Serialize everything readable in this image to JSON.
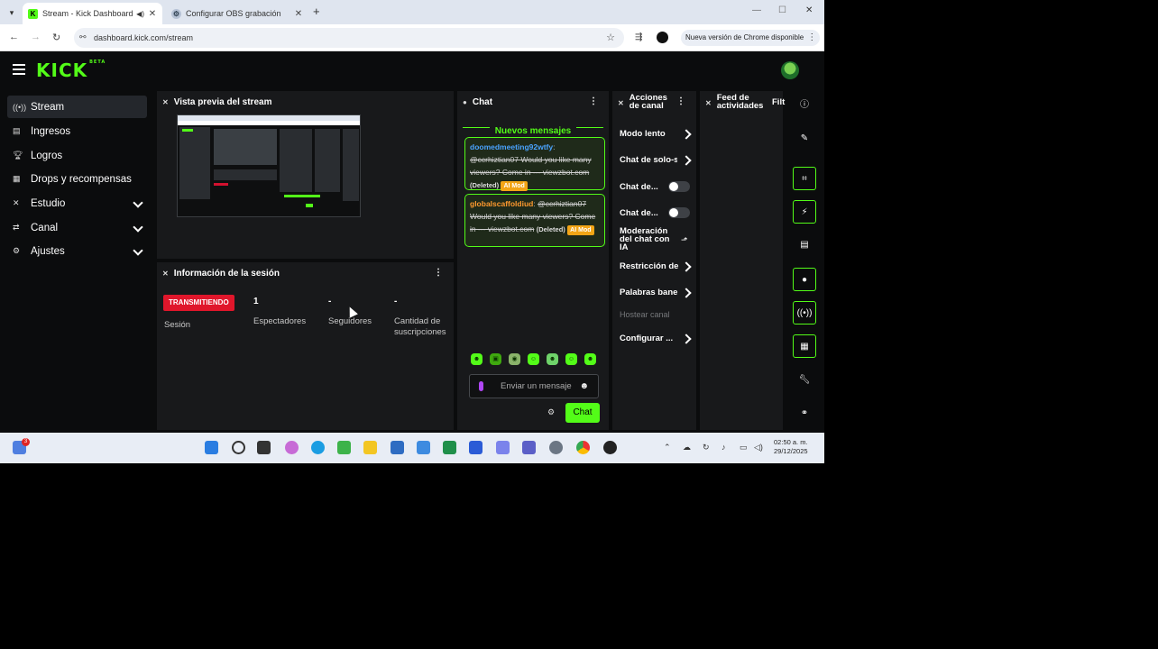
{
  "browser": {
    "tabs": [
      {
        "title": "Stream - Kick Dashboard",
        "active": true
      },
      {
        "title": "Configurar OBS grabación",
        "active": false
      }
    ],
    "address": "dashboard.kick.com/stream",
    "update_pill": "Nueva versión de Chrome disponible"
  },
  "app": {
    "logo": "KICK",
    "logo_tag": "BETA"
  },
  "sidebar": {
    "items": [
      {
        "label": "Stream",
        "icon": "stream-icon",
        "active": true
      },
      {
        "label": "Ingresos",
        "icon": "revenue-icon"
      },
      {
        "label": "Logros",
        "icon": "trophy-icon"
      },
      {
        "label": "Drops y recompensas",
        "icon": "drops-icon"
      },
      {
        "label": "Estudio",
        "icon": "studio-icon",
        "expandable": true
      },
      {
        "label": "Canal",
        "icon": "channel-icon",
        "expandable": true
      },
      {
        "label": "Ajustes",
        "icon": "gear-icon",
        "expandable": true
      }
    ]
  },
  "preview": {
    "title": "Vista previa del stream"
  },
  "session": {
    "title": "Información de la sesión",
    "badge": "TRANSMITIENDO",
    "badge_label": "Sesión",
    "stats": [
      {
        "value": "1",
        "label": "Espectadores"
      },
      {
        "value": "-",
        "label": "Seguidores"
      },
      {
        "value": "-",
        "label": "Cantidad de suscripciones"
      }
    ]
  },
  "chat": {
    "title": "Chat",
    "new_messages": "Nuevos mensajes",
    "messages": [
      {
        "user": "doomedmeeting92wtfy",
        "user_color": "#4aa3ff",
        "text": "@ccrhiztian07 Would you like many viewers? Come in --- viewzbot.com",
        "deleted": "(Deleted)",
        "badge": "AI Mod"
      },
      {
        "user": "globalscaffoldiud",
        "user_color": "#ff9a2e",
        "text": "@ccrhiztian07 Would you like many viewers? Come in --- viewzbot.com",
        "deleted": "(Deleted)",
        "badge": "AI Mod"
      }
    ],
    "input_placeholder": "Enviar un mensaje",
    "send_label": "Chat"
  },
  "actions": {
    "title": "Acciones de canal",
    "items": [
      {
        "label": "Modo lento",
        "kind": "arrow"
      },
      {
        "label": "Chat de solo-s",
        "kind": "arrow"
      },
      {
        "label": "Chat de...",
        "kind": "toggle",
        "on": false
      },
      {
        "label": "Chat de...",
        "kind": "toggle",
        "on": false
      },
      {
        "label": "Moderación del chat con IA",
        "kind": "icon"
      },
      {
        "label": "Restricción de",
        "kind": "arrow"
      },
      {
        "label": "Palabras bane",
        "kind": "arrow"
      },
      {
        "label": "Hostear canal",
        "kind": "disabled"
      },
      {
        "label": "Configurar ...",
        "kind": "arrow"
      }
    ]
  },
  "activity": {
    "title": "Feed de actividades",
    "filter": "Filt"
  },
  "rail": [
    "info-icon",
    "edit-icon",
    "focus-icon",
    "bolt-icon",
    "notes-icon",
    "chat-bubble-icon",
    "broadcast-icon",
    "layout-icon",
    "wrench-icon",
    "share-icon"
  ],
  "taskbar": {
    "time": "02:50 a. m.",
    "date": "29/12/2025",
    "notification_count": "3"
  },
  "colors": {
    "accent": "#53fc18",
    "live": "#e0162b",
    "ai_mod": "#f2a516"
  }
}
